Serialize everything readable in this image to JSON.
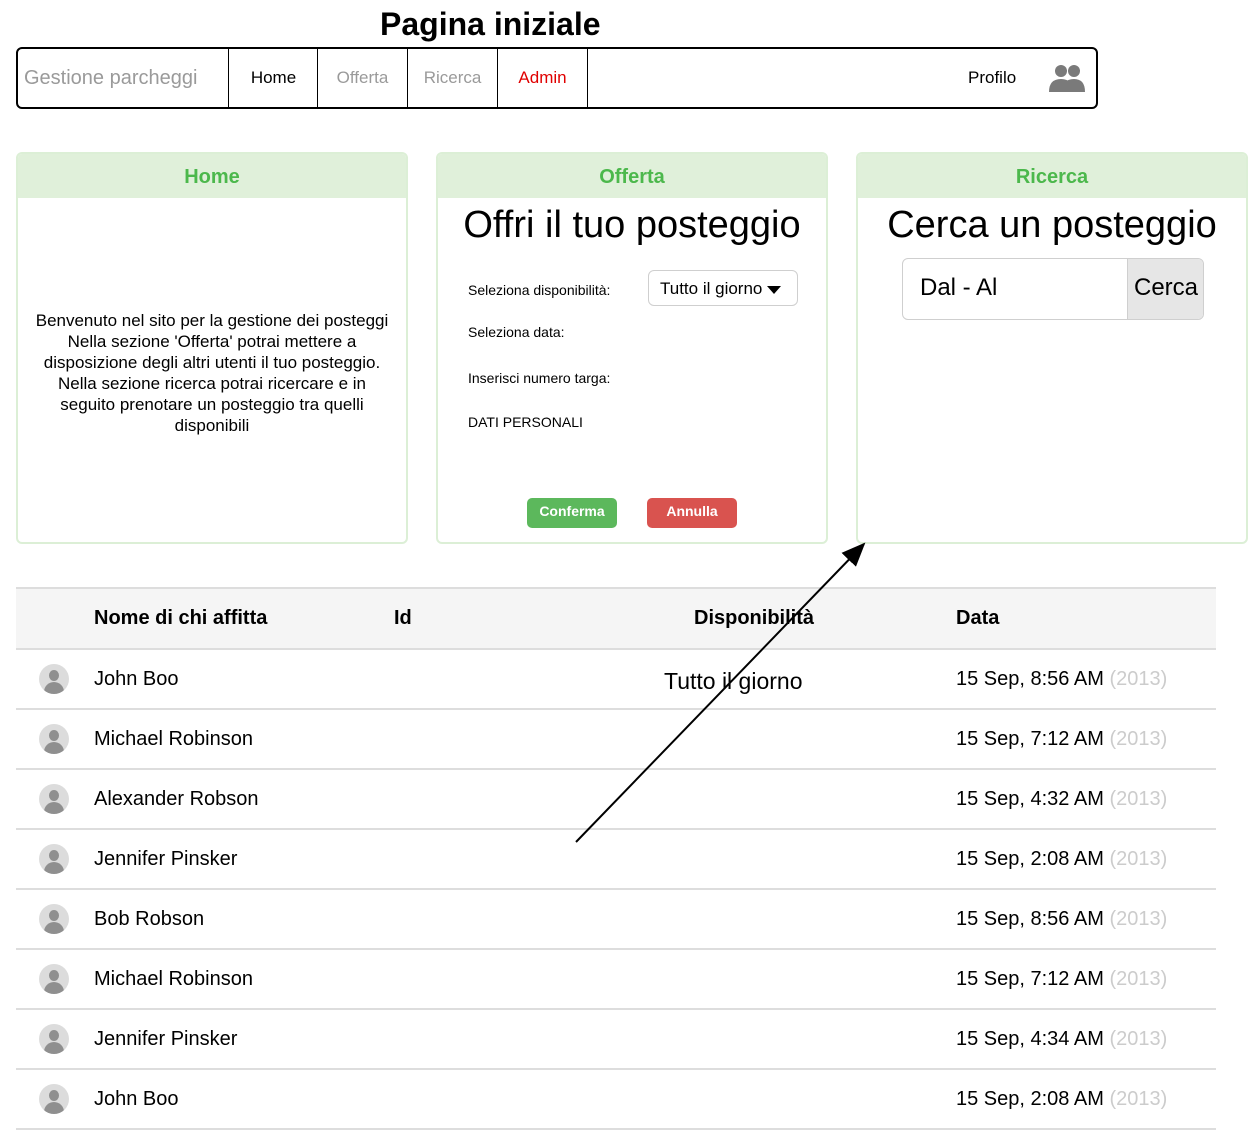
{
  "page_title": "Pagina iniziale",
  "navbar": {
    "brand": "Gestione parcheggi",
    "items": [
      {
        "label": "Home"
      },
      {
        "label": "Offerta"
      },
      {
        "label": "Ricerca"
      },
      {
        "label": "Admin"
      }
    ],
    "profile_label": "Profilo",
    "profile_icon": "users-icon"
  },
  "panels": {
    "home": {
      "header": "Home",
      "welcome_lines": [
        "Benvenuto nel sito per la gestione dei posteggi",
        "Nella sezione 'Offerta' potrai mettere a",
        "disposizione degli altri utenti il tuo posteggio.",
        "Nella sezione ricerca potrai ricercare e in",
        "seguito prenotare un posteggio tra quelli",
        "disponibili"
      ]
    },
    "offerta": {
      "header": "Offerta",
      "title": "Offri il tuo posteggio",
      "availability_label": "Seleziona disponibilità:",
      "availability_value": "Tutto il giorno",
      "date_label": "Seleziona data:",
      "plate_label": "Inserisci numero targa:",
      "personal_label": "DATI PERSONALI",
      "confirm_label": "Conferma",
      "cancel_label": "Annulla"
    },
    "ricerca": {
      "header": "Ricerca",
      "title": "Cerca un posteggio",
      "input_value": "Dal - Al",
      "search_label": "Cerca"
    }
  },
  "table": {
    "headers": [
      "Nome di chi affitta",
      "Id",
      "Disponibilità",
      "Data"
    ],
    "rows": [
      {
        "name": "John Boo",
        "id": "",
        "availability": "Tutto il giorno",
        "date": "15 Sep, 8:56 AM",
        "year": "(2013)"
      },
      {
        "name": "Michael Robinson",
        "id": "",
        "availability": "",
        "date": "15 Sep, 7:12 AM",
        "year": "(2013)"
      },
      {
        "name": "Alexander Robson",
        "id": "",
        "availability": "",
        "date": "15 Sep, 4:32 AM",
        "year": "(2013)"
      },
      {
        "name": "Jennifer Pinsker",
        "id": "",
        "availability": "",
        "date": "15 Sep, 2:08 AM",
        "year": "(2013)"
      },
      {
        "name": "Bob Robson",
        "id": "",
        "availability": "",
        "date": "15 Sep, 8:56 AM",
        "year": "(2013)"
      },
      {
        "name": "Michael Robinson",
        "id": "",
        "availability": "",
        "date": "15 Sep, 7:12 AM",
        "year": "(2013)"
      },
      {
        "name": "Jennifer Pinsker",
        "id": "",
        "availability": "",
        "date": "15 Sep, 4:34 AM",
        "year": "(2013)"
      },
      {
        "name": "John Boo",
        "id": "",
        "availability": "",
        "date": "15 Sep, 2:08 AM",
        "year": "(2013)"
      }
    ]
  },
  "colors": {
    "panel_header_bg": "#e0f0da",
    "panel_header_text": "#4cb84c",
    "admin_text": "#e00000",
    "confirm_button": "#5cb85c",
    "cancel_button": "#d9534f"
  }
}
